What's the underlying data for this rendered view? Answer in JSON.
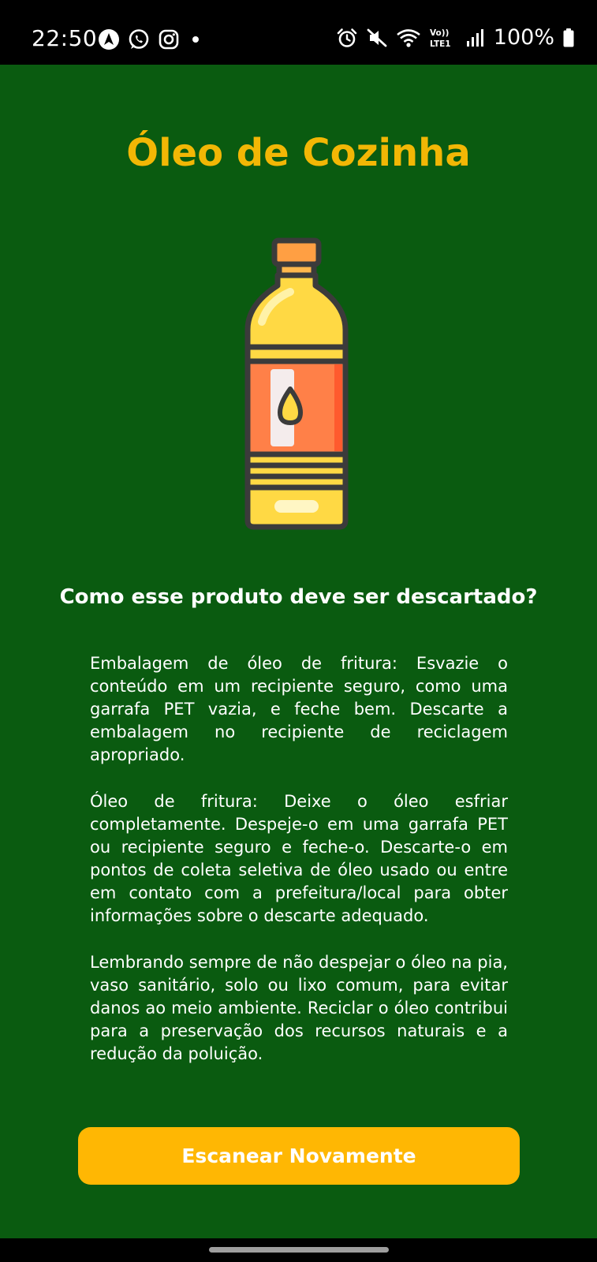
{
  "status_bar": {
    "time": "22:50",
    "left_icons": [
      "navigation-app-icon",
      "whatsapp-icon",
      "instagram-icon",
      "notification-dot-icon"
    ],
    "right_icons": [
      "alarm-icon",
      "mute-icon",
      "wifi-icon",
      "volte-lte-icon",
      "signal-icon",
      "battery-icon"
    ],
    "volte_label": "Vo))",
    "lte_label": "LTE1",
    "battery_text": "100%"
  },
  "page": {
    "title": "Óleo de Cozinha",
    "product_image_icon": "oil-bottle-icon",
    "question": "Como esse produto deve ser descartado?",
    "instructions": [
      "Embalagem de óleo de fritura: Esvazie o conteúdo em um recipiente seguro, como uma garrafa PET vazia, e feche bem. Descarte a embalagem no recipiente de reciclagem apropriado.",
      "Óleo de fritura: Deixe o óleo esfriar completamente. Despeje-o em uma garrafa PET ou recipiente seguro e feche-o. Descarte-o em pontos de coleta seletiva de óleo usado ou entre em contato com a prefeitura/local para obter informações sobre o descarte adequado.",
      "Lembrando sempre de não despejar o óleo na pia, vaso sanitário, solo ou lixo comum, para evitar danos ao meio ambiente. Reciclar o óleo contribui para a preservação dos recursos naturais e a redução da poluição."
    ],
    "button_label": "Escanear Novamente"
  },
  "colors": {
    "background": "#0a5b10",
    "title": "#f2b705",
    "button": "#ffb703",
    "text": "#ffffff"
  }
}
